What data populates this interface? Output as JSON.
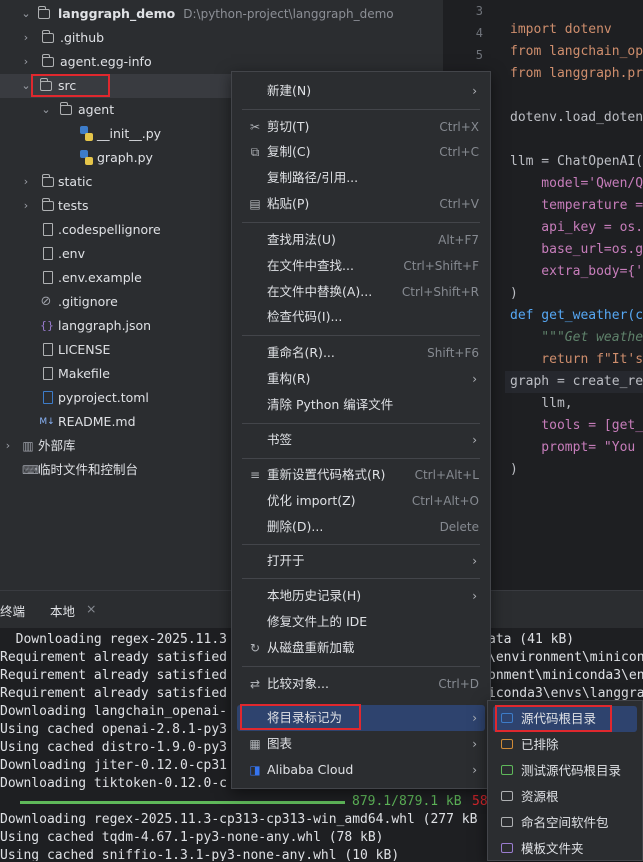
{
  "tree": {
    "root_name": "langgraph_demo",
    "root_path": "D:\\python-project\\langgraph_demo",
    "items": [
      {
        "label": ".github"
      },
      {
        "label": "agent.egg-info"
      },
      {
        "label": "src"
      },
      {
        "label": "agent"
      },
      {
        "label": "__init__.py"
      },
      {
        "label": "graph.py"
      },
      {
        "label": "static"
      },
      {
        "label": "tests"
      },
      {
        "label": ".codespellignore"
      },
      {
        "label": ".env"
      },
      {
        "label": ".env.example"
      },
      {
        "label": ".gitignore"
      },
      {
        "label": "langgraph.json"
      },
      {
        "label": "LICENSE"
      },
      {
        "label": "Makefile"
      },
      {
        "label": "pyproject.toml"
      },
      {
        "label": "README.md"
      },
      {
        "label": "外部库"
      },
      {
        "label": "临时文件和控制台"
      }
    ]
  },
  "editor": {
    "line_numbers": [
      "3",
      "4",
      "5"
    ],
    "lines": [
      "import dotenv",
      "from langchain_op",
      "from langgraph.pr",
      "dotenv.load_doten",
      "llm = ChatOpenAI(",
      "    model='Qwen/Q",
      "    temperature =",
      "    api_key = os.",
      "    base_url=os.g",
      "    extra_body={'",
      ")",
      "def get_weather(c",
      "    \"\"\"Get weathe",
      "    return f\"It's",
      "graph = create_re",
      "    llm,",
      "    tools = [get_",
      "    prompt= \"You",
      ")"
    ]
  },
  "terminal": {
    "tabs": [
      "终端",
      "本地"
    ],
    "lines": [
      "  Downloading regex-2025.11.3",
      "Requirement already satisfied",
      "Requirement already satisfied",
      "Requirement already satisfied",
      "Downloading langchain_openai-",
      "Using cached openai-2.8.1-py3",
      "Using cached distro-1.9.0-py3",
      "Downloading jiter-0.12.0-cp31",
      "Downloading tiktoken-0.12.0-c",
      "Downloading regex-2025.11.3-cp313-cp313-win_amd64.whl (277 kB",
      "Using cached tqdm-4.67.1-py3-none-any.whl (78 kB)",
      "Using cached sniffio-1.3.1-py3-none-any.whl (10 kB)"
    ],
    "right_fragments": [
      "ata (41 kB)",
      "\\environment\\minicon",
      "onment\\miniconda3\\en",
      "iconda3\\envs\\langgra"
    ],
    "progress_text": "879.1/879.1 kB",
    "progress_speed": "58",
    "progress_value": 1.0
  },
  "context_menu": {
    "items": [
      {
        "label": "新建(N)",
        "shortcut": ""
      },
      {
        "label": "剪切(T)",
        "shortcut": "Ctrl+X"
      },
      {
        "label": "复制(C)",
        "shortcut": "Ctrl+C"
      },
      {
        "label": "复制路径/引用...",
        "shortcut": ""
      },
      {
        "label": "粘贴(P)",
        "shortcut": "Ctrl+V"
      },
      {
        "label": "查找用法(U)",
        "shortcut": "Alt+F7"
      },
      {
        "label": "在文件中查找...",
        "shortcut": "Ctrl+Shift+F"
      },
      {
        "label": "在文件中替换(A)...",
        "shortcut": "Ctrl+Shift+R"
      },
      {
        "label": "检查代码(I)...",
        "shortcut": ""
      },
      {
        "label": "重命名(R)...",
        "shortcut": "Shift+F6"
      },
      {
        "label": "重构(R)",
        "shortcut": ""
      },
      {
        "label": "清除 Python 编译文件",
        "shortcut": ""
      },
      {
        "label": "书签",
        "shortcut": ""
      },
      {
        "label": "重新设置代码格式(R)",
        "shortcut": "Ctrl+Alt+L"
      },
      {
        "label": "优化 import(Z)",
        "shortcut": "Ctrl+Alt+O"
      },
      {
        "label": "删除(D)...",
        "shortcut": "Delete"
      },
      {
        "label": "打开于",
        "shortcut": ""
      },
      {
        "label": "本地历史记录(H)",
        "shortcut": ""
      },
      {
        "label": "修复文件上的 IDE",
        "shortcut": ""
      },
      {
        "label": "从磁盘重新加载",
        "shortcut": ""
      },
      {
        "label": "比较对象...",
        "shortcut": "Ctrl+D"
      },
      {
        "label": "将目录标记为",
        "shortcut": ""
      },
      {
        "label": "图表",
        "shortcut": ""
      },
      {
        "label": "Alibaba Cloud",
        "shortcut": ""
      }
    ]
  },
  "submenu": {
    "items": [
      {
        "label": "源代码根目录",
        "color": "#3d7cc9"
      },
      {
        "label": "已排除",
        "color": "#d08b37"
      },
      {
        "label": "测试源代码根目录",
        "color": "#5fb85a"
      },
      {
        "label": "资源根",
        "color": "#afb1b3"
      },
      {
        "label": "命名空间软件包",
        "color": "#afb1b3"
      },
      {
        "label": "模板文件夹",
        "color": "#9a7cd0"
      }
    ]
  },
  "colors": {
    "selection": "#2e436e",
    "highlight_box": "#e0282e"
  }
}
